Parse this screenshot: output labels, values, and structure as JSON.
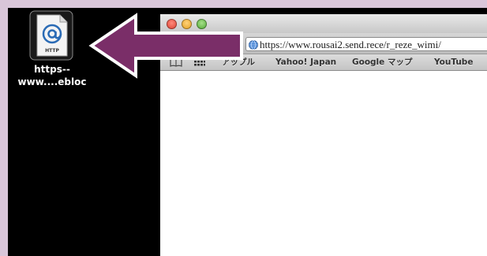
{
  "colors": {
    "frame": "#d9c6d9",
    "desktop": "#000000",
    "arrow_fill": "#7a2e68",
    "arrow_border": "#ffffff"
  },
  "desktop_file": {
    "icon": "webloc-file-icon",
    "icon_badge": "HTTP",
    "label_line1": "https--",
    "label_line2": "www....ebloc"
  },
  "browser": {
    "window_controls": [
      "close",
      "minimize",
      "zoom"
    ],
    "address_bar": {
      "icon": "globe-icon",
      "url": "https://www.rousai2.send.rece/r_reze_wimi/"
    },
    "bookmarks_bar": {
      "icons": [
        "reading-list-icon",
        "top-sites-grid-icon"
      ],
      "items": [
        "アップル",
        "Yahoo! Japan",
        "Google マップ",
        "YouTube"
      ]
    }
  },
  "annotation": {
    "arrow_direction": "left",
    "arrow_icon": "left-arrow-icon"
  }
}
